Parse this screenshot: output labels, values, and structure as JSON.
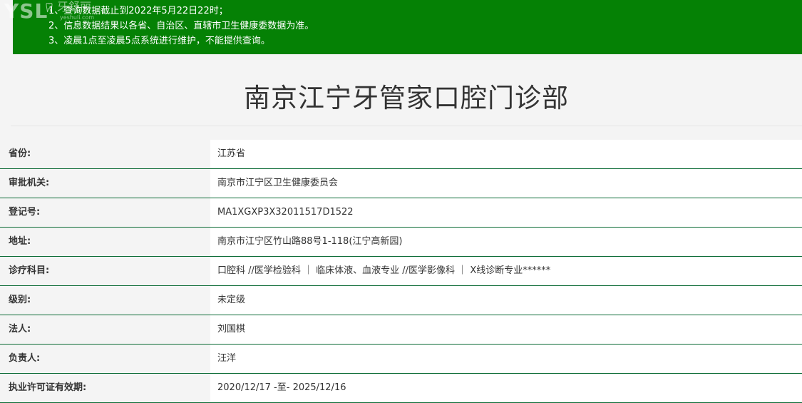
{
  "logo": {
    "text": "YSL",
    "cn": "牙舒丽",
    "en": "yeshuli.com"
  },
  "notice": {
    "lines": [
      "1、查询数据截止到2022年5月22日22时；",
      "2、信息数据结果以各省、自治区、直辖市卫生健康委数据为准。",
      "3、凌晨1点至凌晨5点系统进行维护，不能提供查询。"
    ]
  },
  "title": "南京江宁牙管家口腔门诊部",
  "rows": [
    {
      "label": "省份:",
      "value": "江苏省"
    },
    {
      "label": "审批机关:",
      "value": "南京市江宁区卫生健康委员会"
    },
    {
      "label": "登记号:",
      "value": "MA1XGXP3X32011517D1522"
    },
    {
      "label": "地址:",
      "value": "南京市江宁区竹山路88号1-118(江宁高新园)"
    },
    {
      "label": "诊疗科目:",
      "value": "口腔科 //医学检验科 ｜ 临床体液、血液专业 //医学影像科 ｜ X线诊断专业******"
    },
    {
      "label": "级别:",
      "value": "未定级"
    },
    {
      "label": "法人:",
      "value": "刘国棋"
    },
    {
      "label": "负责人:",
      "value": "汪洋"
    },
    {
      "label": "执业许可证有效期:",
      "value": "2020/12/17 -至- 2025/12/16"
    }
  ],
  "colors": {
    "notice_bg": "#058105",
    "row_border": "#0b6b35"
  }
}
